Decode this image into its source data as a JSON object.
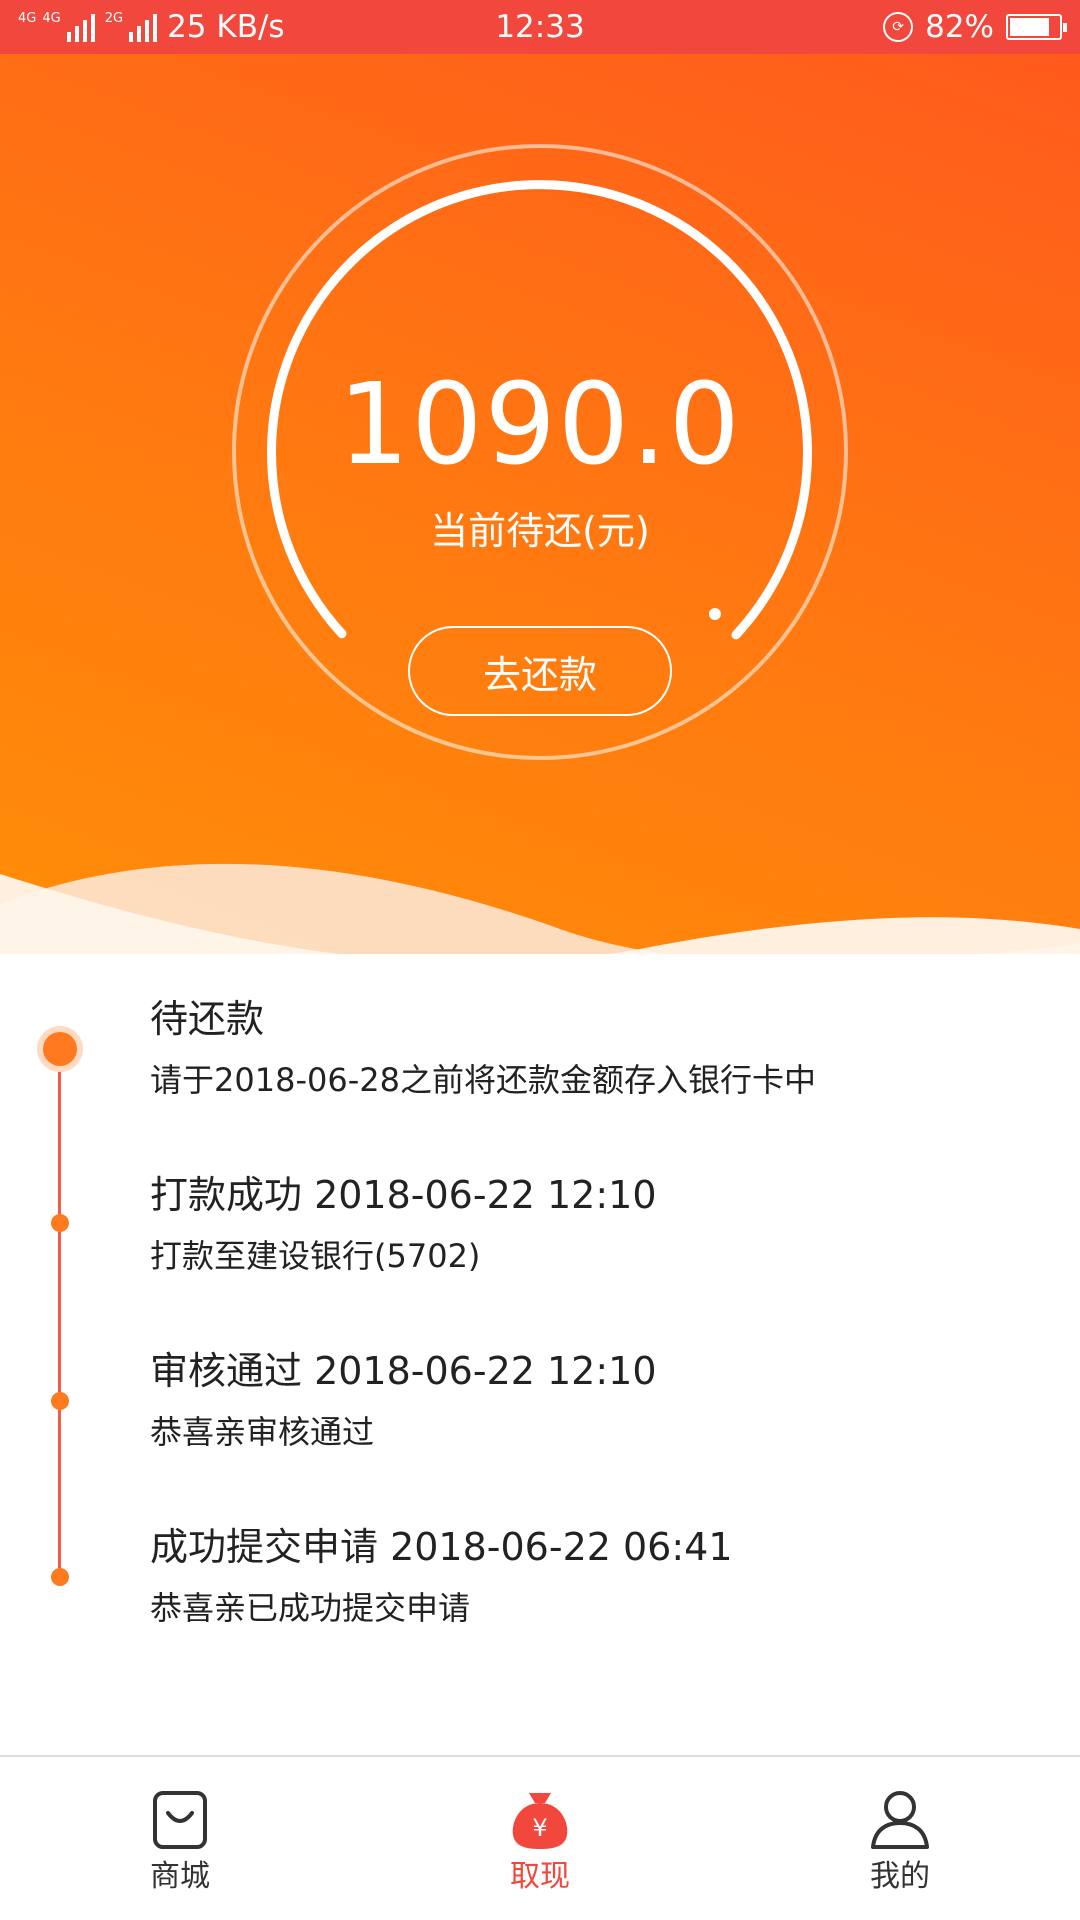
{
  "status_bar": {
    "net1": "4G",
    "net2": "4G",
    "net3": "2G",
    "speed": "25 KB/s",
    "time": "12:33",
    "battery": "82%",
    "battery_level": 0.82
  },
  "hero": {
    "amount": "1090.0",
    "amount_label": "当前待还(元)",
    "repay_button": "去还款"
  },
  "timeline": {
    "items": [
      {
        "title": "待还款",
        "desc": "请于2018-06-28之前将还款金额存入银行卡中"
      },
      {
        "title": "打款成功 2018-06-22 12:10",
        "desc": "打款至建设银行(5702)"
      },
      {
        "title": "审核通过 2018-06-22 12:10",
        "desc": "恭喜亲审核通过"
      },
      {
        "title": "成功提交申请 2018-06-22 06:41",
        "desc": "恭喜亲已成功提交申请"
      }
    ]
  },
  "nav": {
    "items": [
      {
        "label": "商城",
        "icon": "shopping-bag-icon"
      },
      {
        "label": "取现",
        "icon": "money-bag-icon",
        "active": true
      },
      {
        "label": "我的",
        "icon": "user-icon"
      }
    ]
  },
  "colors": {
    "status_bar": "#f2473d",
    "accent_orange": "#ff7512",
    "timeline_line": "#f25a4b",
    "timeline_dot": "#ff7a1e",
    "active_nav": "#f2473d"
  }
}
